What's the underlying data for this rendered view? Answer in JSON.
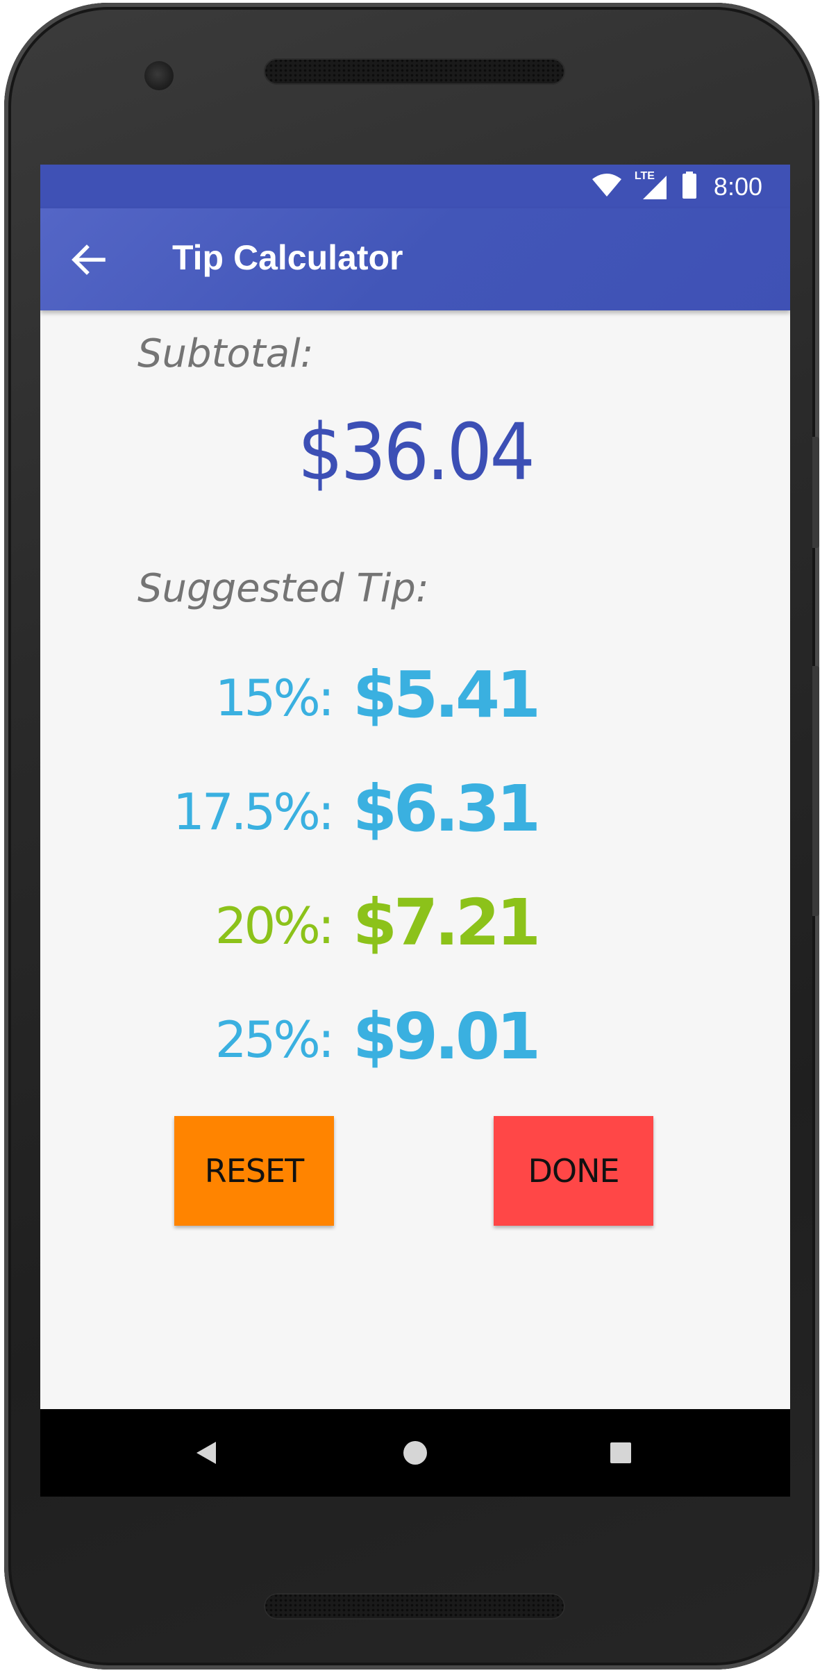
{
  "status_bar": {
    "time": "8:00",
    "network_label": "LTE",
    "icons": [
      "wifi-icon",
      "signal-icon",
      "battery-icon"
    ]
  },
  "app_bar": {
    "title": "Tip Calculator",
    "back_icon": "arrow-back-icon"
  },
  "subtotal": {
    "label": "Subtotal:",
    "value": "$36.04"
  },
  "suggested_tip": {
    "label": "Suggested Tip:",
    "rows": [
      {
        "percent": "15%:",
        "amount": "$5.41",
        "color": "#3ab0e0"
      },
      {
        "percent": "17.5%:",
        "amount": "$6.31",
        "color": "#3ab0e0"
      },
      {
        "percent": "20%:",
        "amount": "$7.21",
        "color": "#8cc21a"
      },
      {
        "percent": "25%:",
        "amount": "$9.01",
        "color": "#3ab0e0"
      }
    ]
  },
  "buttons": {
    "reset": {
      "label": "RESET",
      "color": "#ff8400"
    },
    "done": {
      "label": "DONE",
      "color": "#ff4747"
    }
  },
  "nav_bar": {
    "icons": [
      "nav-back-icon",
      "nav-home-icon",
      "nav-recents-icon"
    ]
  },
  "colors": {
    "primary": "#3f51b5",
    "subtotal_value": "#3c4fb5",
    "label_gray": "#747474",
    "screen_background": "#f6f6f6"
  }
}
